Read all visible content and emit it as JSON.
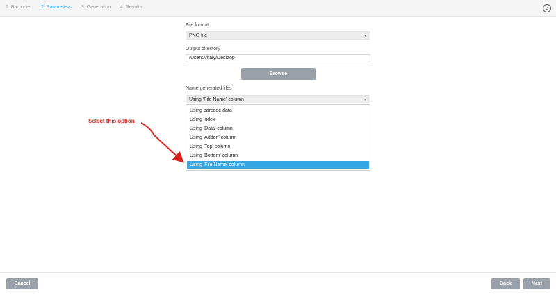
{
  "steps": [
    {
      "label": "1. Barcodes",
      "active": false
    },
    {
      "label": "2. Parameters",
      "active": true
    },
    {
      "label": "3. Generation",
      "active": false
    },
    {
      "label": "4. Results",
      "active": false
    }
  ],
  "help": {
    "icon": "question-icon",
    "glyph": "?"
  },
  "file_format": {
    "label": "File format",
    "value": "PNG file"
  },
  "output_directory": {
    "label": "Output directory",
    "value": "/Users/vitaly/Desktop"
  },
  "browse_label": "Browse",
  "name_generated": {
    "label": "Name generated files",
    "value": "Using 'File Name' column",
    "options": [
      "Using barcode data",
      "Using index",
      "Using 'Data' column",
      "Using 'Addon' column",
      "Using 'Top' column",
      "Using 'Bottom' column",
      "Using 'File Name' column"
    ],
    "selected_option": "Using 'File Name' column"
  },
  "annotation": {
    "text": "Select this option",
    "color": "#d8231f"
  },
  "footer": {
    "cancel": "Cancel",
    "back": "Back",
    "next": "Next"
  },
  "colors": {
    "accent": "#35a5e1",
    "button": "#9aa0aa",
    "active_step": "#3aa6dc"
  }
}
